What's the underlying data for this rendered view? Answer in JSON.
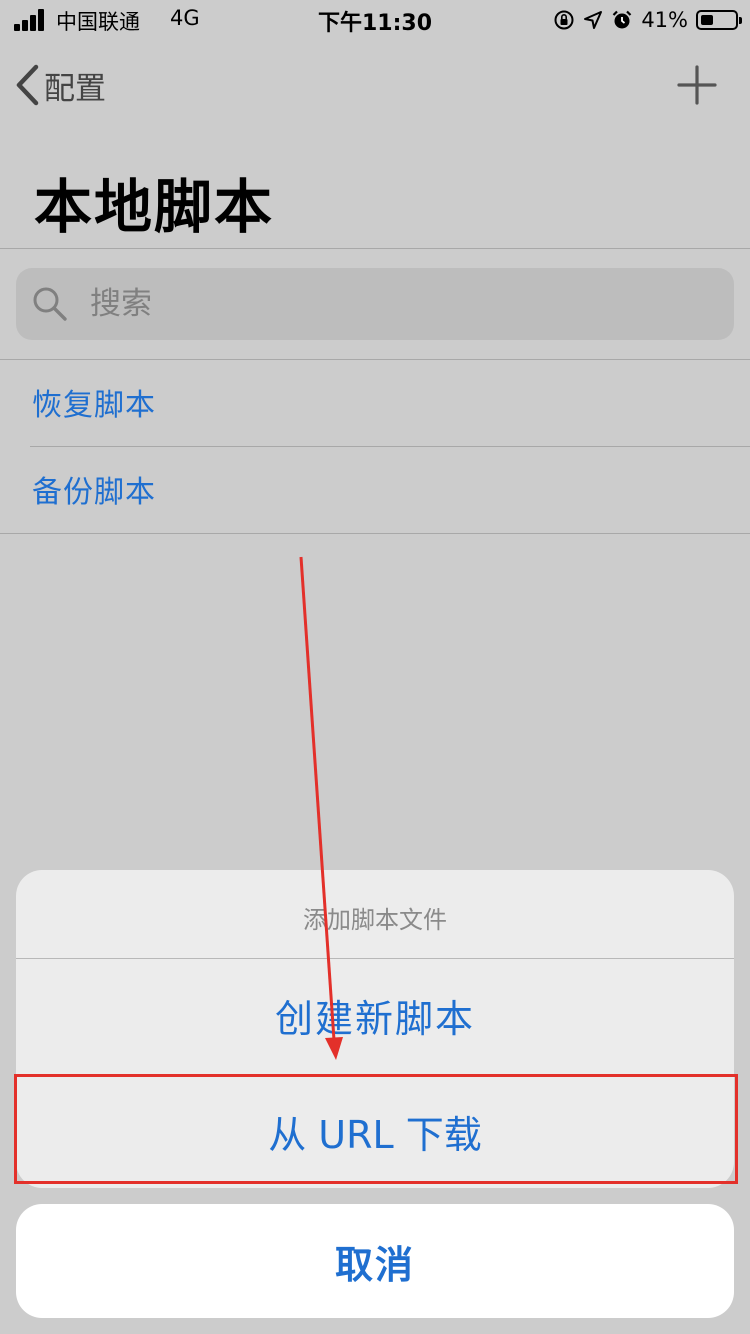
{
  "status_bar": {
    "carrier": "中国联通",
    "network": "4G",
    "time": "下午11:30",
    "battery_percent": "41%",
    "battery_level": 0.41,
    "icons": [
      "signal-bars-icon",
      "orientation-lock-icon",
      "location-arrow-icon",
      "alarm-icon",
      "battery-icon"
    ]
  },
  "nav": {
    "back_label": "配置",
    "add_icon": "plus-icon"
  },
  "page": {
    "title": "本地脚本"
  },
  "search": {
    "placeholder": "搜索",
    "value": ""
  },
  "list": {
    "items": [
      {
        "label": "恢复脚本"
      },
      {
        "label": "备份脚本"
      }
    ]
  },
  "action_sheet": {
    "title": "添加脚本文件",
    "actions": [
      {
        "label": "创建新脚本"
      },
      {
        "label": "从 URL 下载"
      }
    ],
    "cancel_label": "取消"
  },
  "colors": {
    "accent": "#1f6fd0",
    "dim_background": "#cccccc",
    "annotation": "#e3302a"
  }
}
